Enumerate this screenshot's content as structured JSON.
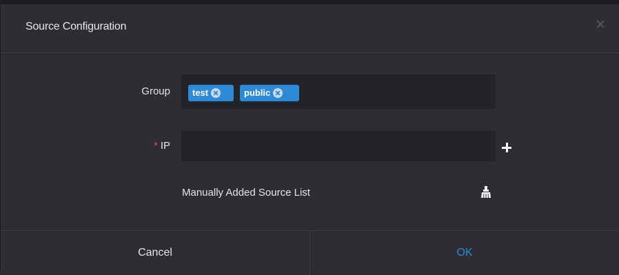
{
  "dialog": {
    "title": "Source Configuration"
  },
  "form": {
    "group_label": "Group",
    "group_tags": [
      "test",
      "public"
    ],
    "ip_required_marker": "*",
    "ip_label": "IP",
    "ip_value": "",
    "manual_list_label": "Manually Added Source List"
  },
  "footer": {
    "cancel_label": "Cancel",
    "ok_label": "OK"
  },
  "icons": {
    "close": "close-icon",
    "tag_remove": "circle-x-icon",
    "add": "plus-icon",
    "clear": "broom-icon"
  },
  "colors": {
    "accent": "#2f8ad6",
    "required": "#e04848",
    "background": "#2d2d33",
    "field": "#23232a"
  }
}
